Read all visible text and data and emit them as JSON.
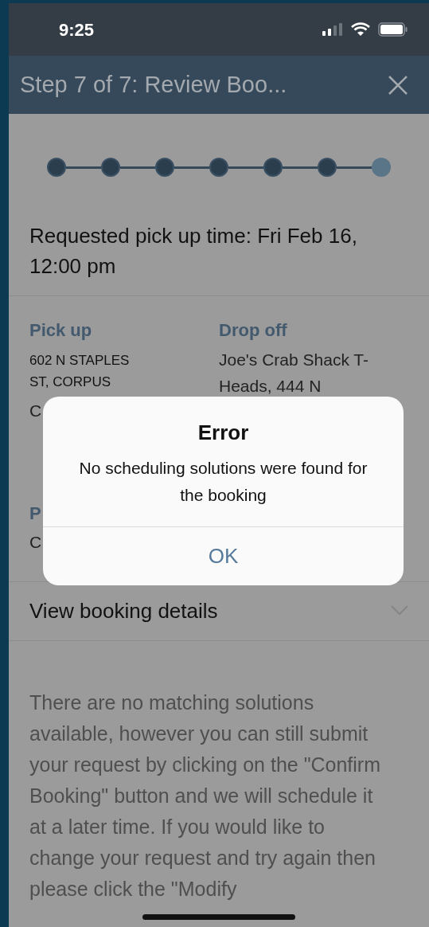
{
  "status_bar": {
    "time": "9:25"
  },
  "header": {
    "title": "Step 7 of 7: Review Boo..."
  },
  "steps": [
    {
      "selected": false
    },
    {
      "selected": false
    },
    {
      "selected": false
    },
    {
      "selected": false
    },
    {
      "selected": false
    },
    {
      "selected": false
    },
    {
      "selected": true
    }
  ],
  "pickup_time": "Requested pick up time: Fri Feb 16, 12:00 pm",
  "pick_up": {
    "label": "Pick up",
    "address": "602 N STAPLES ST, CORPUS",
    "address_cut": "C"
  },
  "drop_off": {
    "label": "Drop off",
    "address": "Joe's Crab Shack T-Heads, 444 N"
  },
  "payment": {
    "label": "P",
    "value": "C"
  },
  "details_toggle": {
    "label": "View booking details",
    "expanded": false
  },
  "note": "There are no matching solutions available, however you can still submit your request by clicking on the \"Confirm Booking\" button and we will schedule it at a later time. If you would like to change your request and try again then please click the \"Modify",
  "dialog": {
    "title": "Error",
    "message": "No scheduling solutions were found for the booking",
    "button": "OK"
  }
}
